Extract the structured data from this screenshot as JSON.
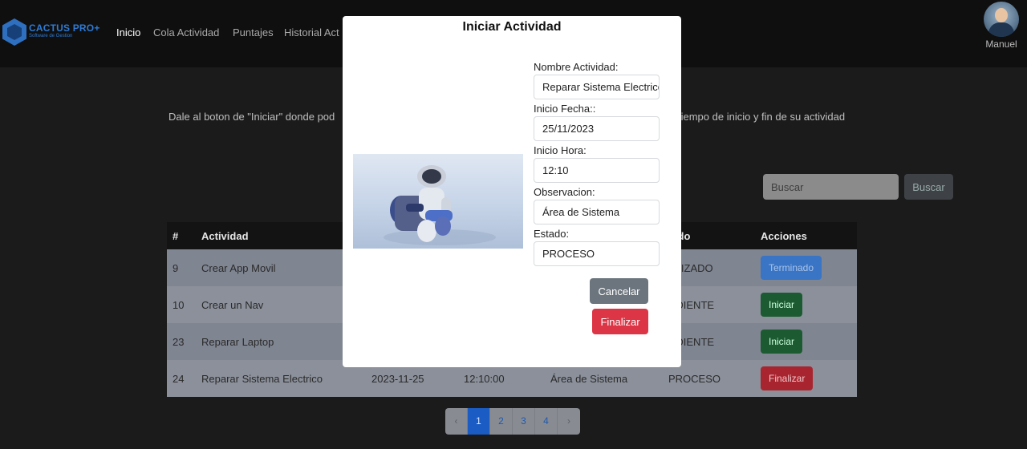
{
  "navbar": {
    "brand_name": "CACTUS PRO+",
    "brand_sub": "Software de Gestion",
    "links": [
      "Inicio",
      "Cola Actividad",
      "Puntajes",
      "Historial Act"
    ],
    "user_name": "Manuel"
  },
  "page": {
    "intro_left": "Dale al boton de \"Iniciar\" donde pod",
    "intro_right": "tiempo de inicio y fin de su actividad",
    "search_placeholder": "Buscar",
    "search_button": "Buscar",
    "table": {
      "headers": [
        "#",
        "Actividad",
        "",
        "",
        "",
        "tado",
        "Acciones"
      ],
      "rows": [
        {
          "id": "9",
          "actividad": "Crear App Movil",
          "fecha": "",
          "hora": "",
          "obs": "",
          "estado": "ALIZADO",
          "accion": "Terminado",
          "accion_color": "blue"
        },
        {
          "id": "10",
          "actividad": "Crear un Nav",
          "fecha": "",
          "hora": "",
          "obs": "",
          "estado": "NDIENTE",
          "accion": "Iniciar",
          "accion_color": "green"
        },
        {
          "id": "23",
          "actividad": "Reparar Laptop",
          "fecha": "",
          "hora": "",
          "obs": "",
          "estado": "NDIENTE",
          "accion": "Iniciar",
          "accion_color": "green"
        },
        {
          "id": "24",
          "actividad": "Reparar Sistema Electrico",
          "fecha": "2023-11-25",
          "hora": "12:10:00",
          "obs": "Área de Sistema",
          "estado": "PROCESO",
          "accion": "Finalizar",
          "accion_color": "red"
        }
      ]
    },
    "pagination": {
      "prev": "‹",
      "pages": [
        "1",
        "2",
        "3",
        "4"
      ],
      "active_page": "1",
      "next": "›"
    }
  },
  "modal": {
    "title": "Iniciar Actividad",
    "image_icon": "robot-illustration",
    "fields": {
      "nombre_label": "Nombre Actividad:",
      "nombre_value": "Reparar Sistema Electrico",
      "fecha_label": "Inicio Fecha::",
      "fecha_value": "25/11/2023",
      "hora_label": "Inicio Hora:",
      "hora_value": "12:10",
      "obs_label": "Observacion:",
      "obs_value": "Área de Sistema",
      "estado_label": "Estado:",
      "estado_value": "PROCESO"
    },
    "cancel_label": "Cancelar",
    "finish_label": "Finalizar"
  },
  "colors": {
    "overlay_bg": "#1b1b1b",
    "primary": "#1a5cc4",
    "danger": "#dc3545",
    "secondary": "#6c757d",
    "success": "#1c5a32"
  }
}
